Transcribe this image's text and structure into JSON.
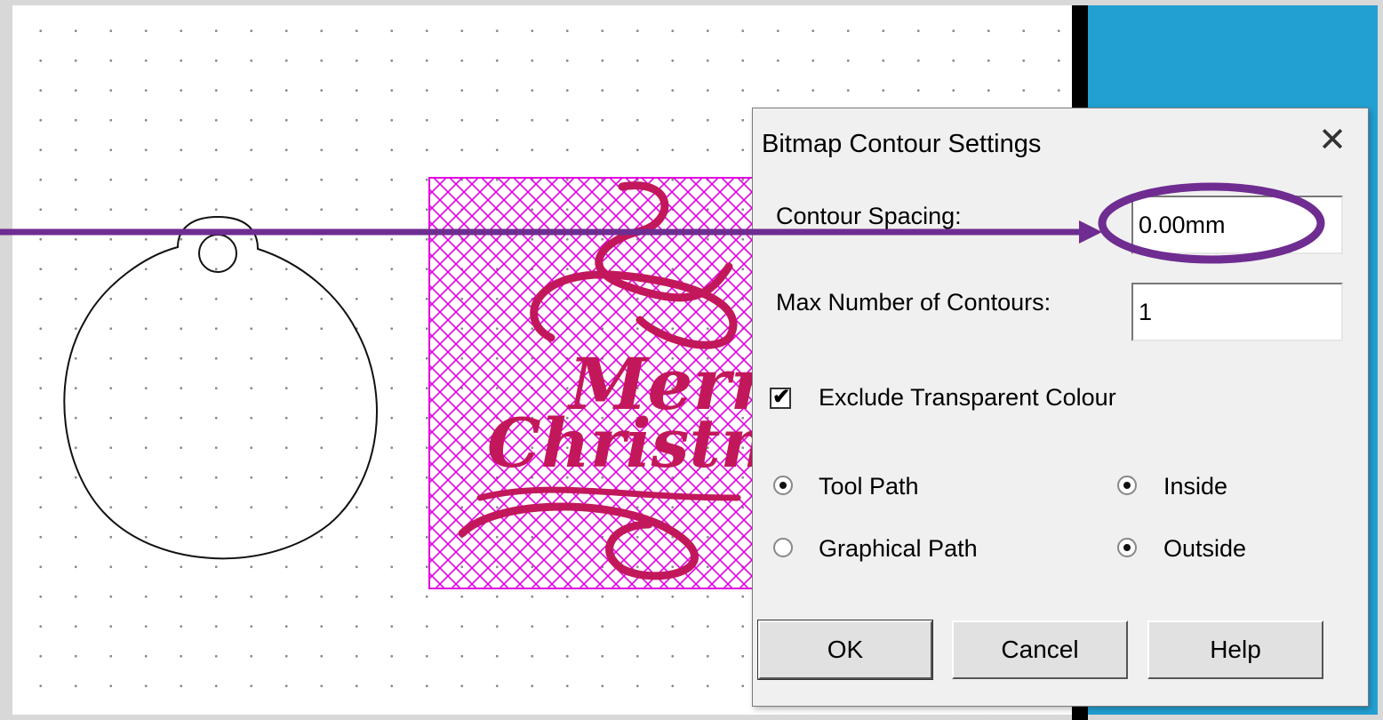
{
  "dialog": {
    "title": "Bitmap Contour Settings",
    "close_glyph": "✕",
    "contour_spacing_label": "Contour Spacing:",
    "contour_spacing_value": "0.00mm",
    "max_contours_label": "Max Number of Contours:",
    "max_contours_value": "1",
    "exclude_transparent_label": "Exclude Transparent Colour",
    "exclude_transparent_checked": true,
    "path_options": [
      {
        "label": "Tool Path",
        "selected": true
      },
      {
        "label": "Graphical Path",
        "selected": false
      }
    ],
    "side_options": [
      {
        "label": "Inside",
        "selected": false
      },
      {
        "label": "Outside",
        "selected": true
      }
    ],
    "buttons": {
      "ok": "OK",
      "cancel": "Cancel",
      "help": "Help"
    }
  },
  "canvas": {
    "image_text_line1": "Merry",
    "image_text_line2": "Christmas"
  },
  "colors": {
    "annotation": "#6f2c91",
    "hatch": "#e000e0",
    "script_text": "#c2185b",
    "side_panel": "#22a0d2"
  }
}
